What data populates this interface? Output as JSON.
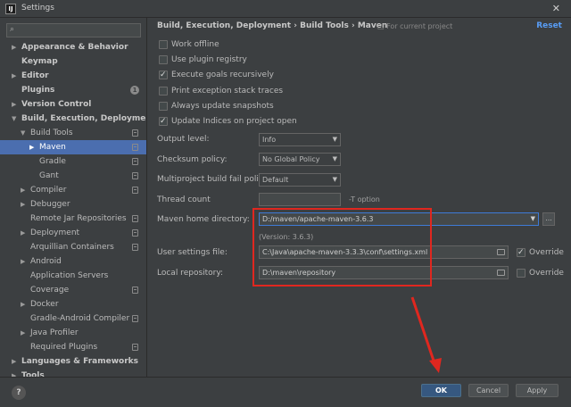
{
  "window": {
    "title": "Settings",
    "close_glyph": "✕",
    "app_icon": "IJ"
  },
  "sidebar": {
    "search_icon": "search-icon",
    "items": [
      {
        "label": "Appearance & Behavior",
        "bold": true,
        "arrow": "▶"
      },
      {
        "label": "Keymap",
        "bold": true,
        "arrow": ""
      },
      {
        "label": "Editor",
        "bold": true,
        "arrow": "▶"
      },
      {
        "label": "Plugins",
        "bold": true,
        "arrow": "",
        "badge": "1"
      },
      {
        "label": "Version Control",
        "bold": true,
        "arrow": "▶"
      },
      {
        "label": "Build, Execution, Deployment",
        "bold": true,
        "arrow": "▼"
      },
      {
        "label": "Build Tools",
        "arrow": "▼"
      },
      {
        "label": "Maven",
        "arrow": "▶",
        "selected": true
      },
      {
        "label": "Gradle",
        "arrow": ""
      },
      {
        "label": "Gant",
        "arrow": ""
      },
      {
        "label": "Compiler",
        "arrow": "▶"
      },
      {
        "label": "Debugger",
        "arrow": "▶"
      },
      {
        "label": "Remote Jar Repositories",
        "arrow": ""
      },
      {
        "label": "Deployment",
        "arrow": "▶"
      },
      {
        "label": "Arquillian Containers",
        "arrow": ""
      },
      {
        "label": "Android",
        "arrow": "▶"
      },
      {
        "label": "Application Servers",
        "arrow": ""
      },
      {
        "label": "Coverage",
        "arrow": ""
      },
      {
        "label": "Docker",
        "arrow": "▶"
      },
      {
        "label": "Gradle-Android Compiler",
        "arrow": ""
      },
      {
        "label": "Java Profiler",
        "arrow": "▶"
      },
      {
        "label": "Required Plugins",
        "arrow": ""
      },
      {
        "label": "Languages & Frameworks",
        "bold": true,
        "arrow": "▶"
      },
      {
        "label": "Tools",
        "bold": true,
        "arrow": "▶"
      }
    ]
  },
  "content": {
    "breadcrumb": "Build, Execution, Deployment  ›  Build Tools  ›  Maven",
    "for_project": "For current project",
    "reset": "Reset",
    "checkboxes": [
      {
        "label": "Work offline",
        "checked": false
      },
      {
        "label": "Use plugin registry",
        "checked": false
      },
      {
        "label": "Execute goals recursively",
        "checked": true
      },
      {
        "label": "Print exception stack traces",
        "checked": false
      },
      {
        "label": "Always update snapshots",
        "checked": false
      },
      {
        "label": "Update Indices on project open",
        "checked": true
      }
    ],
    "output_level": {
      "label": "Output level:",
      "value": "Info"
    },
    "checksum_policy": {
      "label": "Checksum policy:",
      "value": "No Global Policy"
    },
    "multiproject": {
      "label": "Multiproject build fail policy:",
      "value": "Default"
    },
    "thread_count": {
      "label": "Thread count",
      "value": "",
      "hint": "-T option"
    },
    "maven_home": {
      "label": "Maven home directory:",
      "value": "D:/maven/apache-maven-3.6.3",
      "version": "(Version: 3.6.3)",
      "browse": "..."
    },
    "user_settings": {
      "label": "User settings file:",
      "value": "C:\\Java\\apache-maven-3.3.3\\conf\\settings.xml",
      "override_label": "Override",
      "override_checked": true
    },
    "local_repo": {
      "label": "Local repository:",
      "value": "D:\\maven\\repository",
      "override_label": "Override",
      "override_checked": false
    }
  },
  "footer": {
    "help": "?",
    "ok": "OK",
    "cancel": "Cancel",
    "apply": "Apply"
  },
  "colors": {
    "accent": "#4b6eaf",
    "annotation": "#e0271f",
    "link": "#589df6"
  }
}
